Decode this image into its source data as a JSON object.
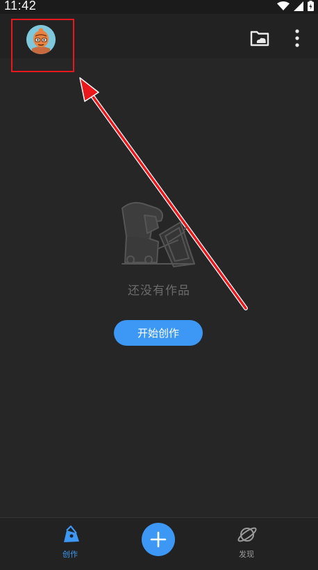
{
  "status_bar": {
    "time": "11:42"
  },
  "top_bar": {
    "avatar": "avatar",
    "actions": [
      "cloud-folder-icon",
      "more-vertical-icon"
    ]
  },
  "empty_state": {
    "message": "还没有作品",
    "button_label": "开始创作"
  },
  "bottom_nav": {
    "items": [
      {
        "label": "创作",
        "icon": "pen-icon",
        "active": true
      },
      {
        "label": "发现",
        "icon": "planet-icon",
        "active": false
      }
    ],
    "fab_icon": "plus-icon"
  },
  "colors": {
    "accent": "#3d98f5",
    "background": "#262626",
    "annotation": "#e8181c"
  }
}
